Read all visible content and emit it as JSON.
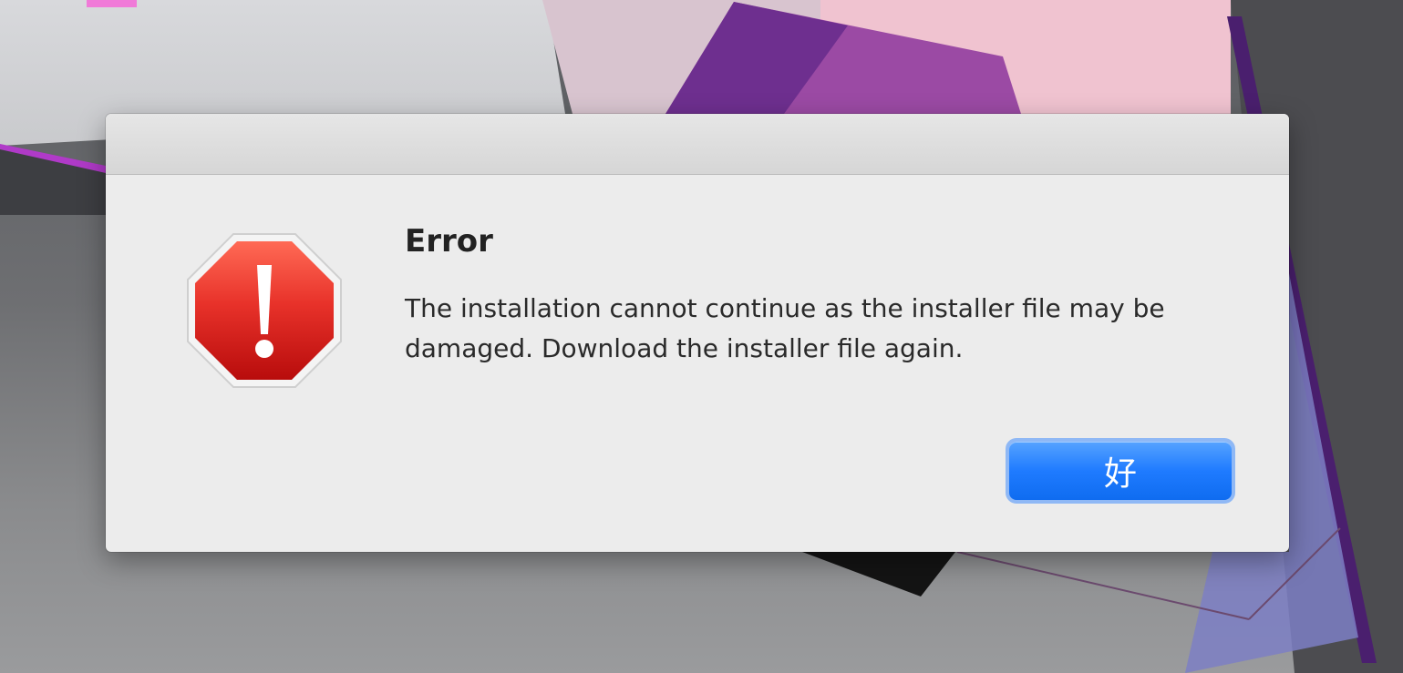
{
  "dialog": {
    "title": "Error",
    "message": "The installation cannot continue as the installer file may be damaged. Download the installer file again.",
    "icon": "stop-alert-icon",
    "ok_label": "好"
  },
  "colors": {
    "alert_red": "#d9211f",
    "button_blue": "#1f7bff",
    "dialog_background": "#ececec"
  }
}
